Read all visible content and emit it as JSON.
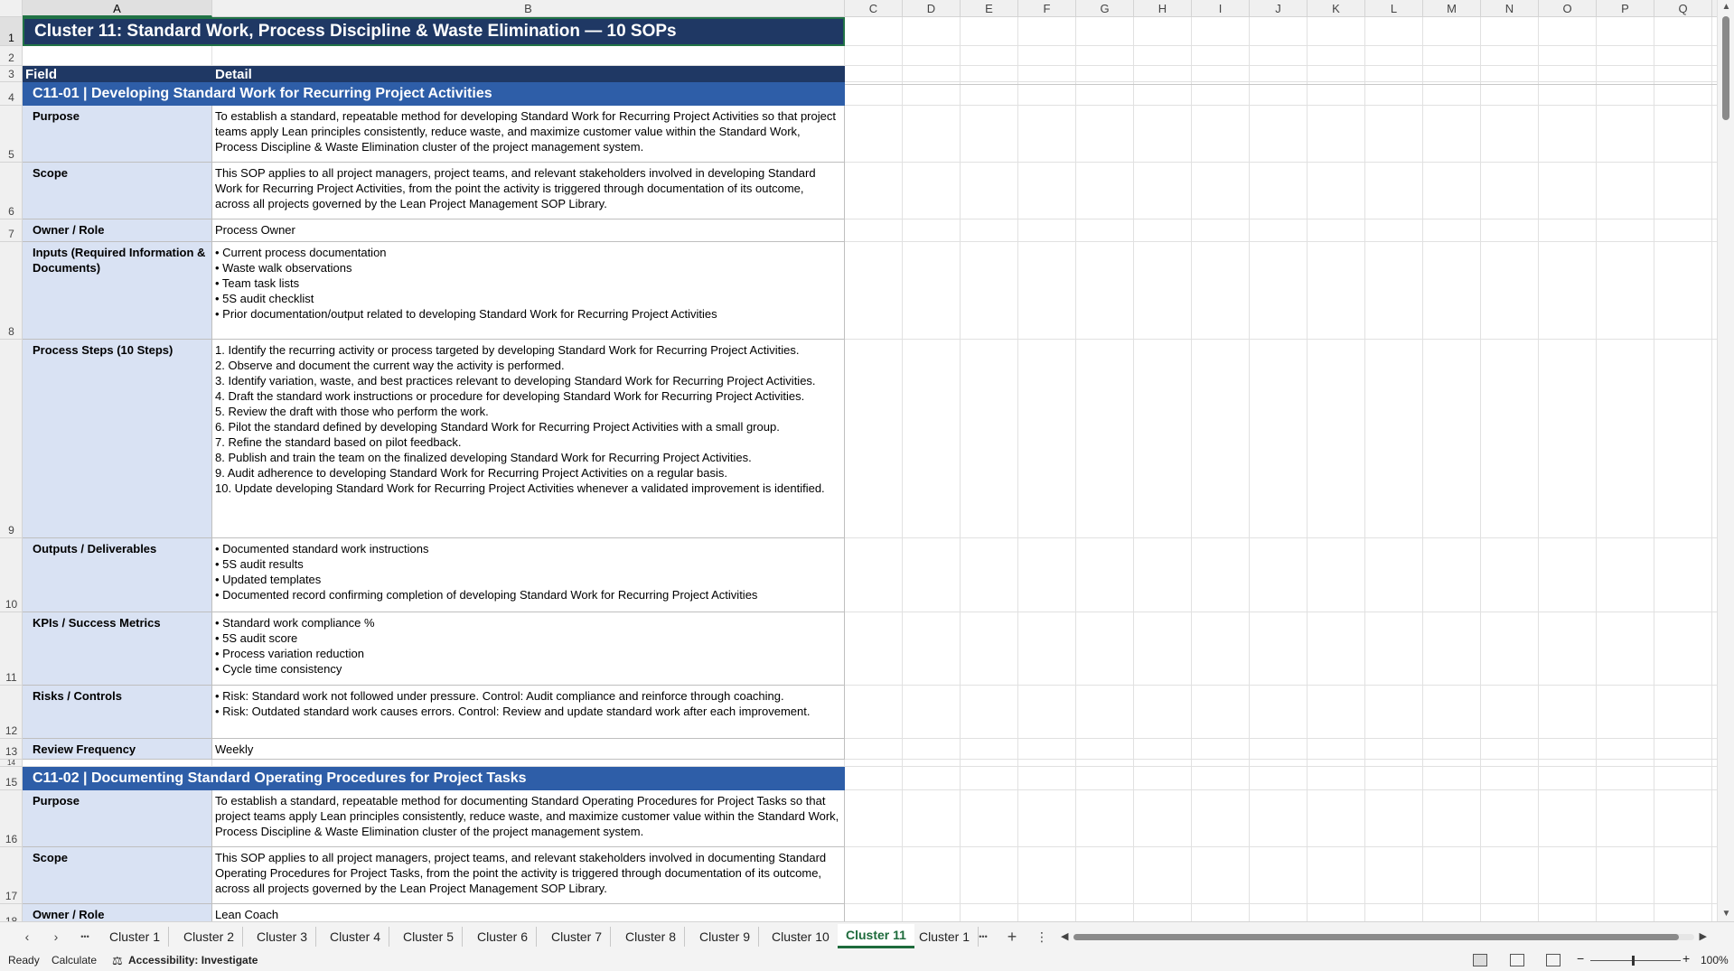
{
  "columns": [
    "A",
    "B",
    "C",
    "D",
    "E",
    "F",
    "G",
    "H",
    "I",
    "J",
    "K",
    "L",
    "M",
    "N",
    "O",
    "P",
    "Q"
  ],
  "rows": [
    "1",
    "2",
    "3",
    "4",
    "5",
    "6",
    "7",
    "8",
    "9",
    "10",
    "11",
    "12",
    "13",
    "14",
    "15",
    "16",
    "17",
    "18"
  ],
  "sheet": {
    "title": "Cluster 11: Standard Work, Process Discipline & Waste Elimination  —  10 SOPs",
    "header_field": "Field",
    "header_detail": "Detail",
    "sop1_title": "C11-01  |  Developing Standard Work for Recurring Project Activities",
    "sop1": [
      {
        "field": "Purpose",
        "detail": "To establish a standard, repeatable method for developing Standard Work for Recurring Project Activities so that project teams apply Lean principles consistently, reduce waste, and maximize customer value within the Standard Work, Process Discipline & Waste Elimination cluster of the project management system."
      },
      {
        "field": "Scope",
        "detail": "This SOP applies to all project managers, project teams, and relevant stakeholders involved in developing Standard Work for Recurring Project Activities, from the point the activity is triggered through documentation of its outcome, across all projects governed by the Lean Project Management SOP Library."
      },
      {
        "field": "Owner / Role",
        "detail": "Process Owner"
      },
      {
        "field": "Inputs (Required Information & Documents)",
        "detail": "• Current process documentation\n• Waste walk observations\n• Team task lists\n• 5S audit checklist\n• Prior documentation/output related to developing Standard Work for Recurring Project Activities"
      },
      {
        "field": "Process Steps (10 Steps)",
        "detail": "1. Identify the recurring activity or process targeted by developing Standard Work for Recurring Project Activities.\n2. Observe and document the current way the activity is performed.\n3. Identify variation, waste, and best practices relevant to developing Standard Work for Recurring Project Activities.\n4. Draft the standard work instructions or procedure for developing Standard Work for Recurring Project Activities.\n5. Review the draft with those who perform the work.\n6. Pilot the standard defined by developing Standard Work for Recurring Project Activities with a small group.\n7. Refine the standard based on pilot feedback.\n8. Publish and train the team on the finalized developing Standard Work for Recurring Project Activities.\n9. Audit adherence to developing Standard Work for Recurring Project Activities on a regular basis.\n10. Update developing Standard Work for Recurring Project Activities whenever a validated improvement is identified."
      },
      {
        "field": "Outputs / Deliverables",
        "detail": "• Documented standard work instructions\n• 5S audit results\n• Updated templates\n• Documented record confirming completion of developing Standard Work for Recurring Project Activities"
      },
      {
        "field": "KPIs / Success Metrics",
        "detail": "• Standard work compliance %\n• 5S audit score\n• Process variation reduction\n• Cycle time consistency"
      },
      {
        "field": "Risks / Controls",
        "detail": "• Risk: Standard work not followed under pressure. Control: Audit compliance and reinforce through coaching.\n• Risk: Outdated standard work causes errors. Control: Review and update standard work after each improvement."
      },
      {
        "field": "Review Frequency",
        "detail": "Weekly"
      }
    ],
    "sop2_title": "C11-02  |  Documenting Standard Operating Procedures for Project Tasks",
    "sop2": [
      {
        "field": "Purpose",
        "detail": "To establish a standard, repeatable method for documenting Standard Operating Procedures for Project Tasks so that project teams apply Lean principles consistently, reduce waste, and maximize customer value within the Standard Work, Process Discipline & Waste Elimination cluster of the project management system."
      },
      {
        "field": "Scope",
        "detail": "This SOP applies to all project managers, project teams, and relevant stakeholders involved in documenting Standard Operating Procedures for Project Tasks, from the point the activity is triggered through documentation of its outcome, across all projects governed by the Lean Project Management SOP Library."
      },
      {
        "field": "Owner / Role",
        "detail": "Lean Coach"
      }
    ]
  },
  "tabs": [
    "Cluster 1",
    "Cluster 2",
    "Cluster 3",
    "Cluster 4",
    "Cluster 5",
    "Cluster 6",
    "Cluster 7",
    "Cluster 8",
    "Cluster 9",
    "Cluster 10",
    "Cluster 11",
    "Cluster 1"
  ],
  "active_tab_index": 10,
  "tab_nav": {
    "prev": "‹",
    "next": "›",
    "more": "•••",
    "add": "+",
    "options": "⋮"
  },
  "status": {
    "ready": "Ready",
    "calculate": "Calculate",
    "accessibility": "Accessibility: Investigate",
    "zoom": "100%"
  },
  "icons": {
    "accessibility": "accessibility-icon",
    "normal_view": "normal-view-icon",
    "page_layout": "page-layout-icon",
    "page_break": "page-break-preview-icon"
  }
}
